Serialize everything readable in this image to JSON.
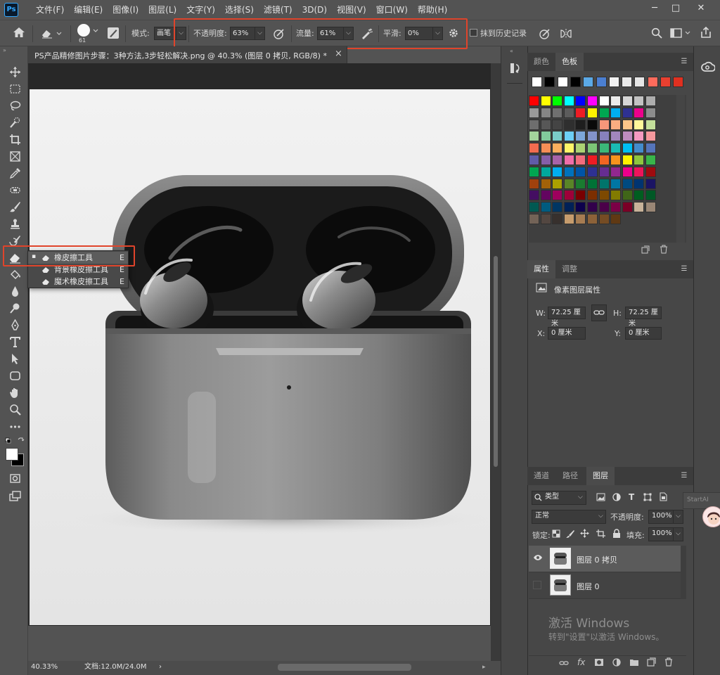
{
  "app": {
    "logo": "Ps"
  },
  "menubar": {
    "items": [
      "文件(F)",
      "编辑(E)",
      "图像(I)",
      "图层(L)",
      "文字(Y)",
      "选择(S)",
      "滤镜(T)",
      "3D(D)",
      "视图(V)",
      "窗口(W)",
      "帮助(H)"
    ]
  },
  "window_controls": {
    "minimize": "─",
    "maximize": "□",
    "close": "✕"
  },
  "options": {
    "brush_size": "61",
    "mode_label": "模式:",
    "mode_value": "画笔",
    "opacity_label": "不透明度:",
    "opacity_value": "63%",
    "flow_label": "流量:",
    "flow_value": "61%",
    "smooth_label": "平滑:",
    "smooth_value": "0%",
    "erase_history_label": "抹到历史记录"
  },
  "document": {
    "tab_title": "PS产品精修图片步骤：3种方法,3步轻松解决.png @ 40.3% (图层 0 拷贝, RGB/8) *",
    "close_glyph": "×",
    "zoom": "40.33%",
    "doc_size": "文档:12.0M/24.0M",
    "arrow": "›"
  },
  "tool_flyout": {
    "items": [
      {
        "label": "橡皮擦工具",
        "shortcut": "E",
        "active": true
      },
      {
        "label": "背景橡皮擦工具",
        "shortcut": "E",
        "active": false
      },
      {
        "label": "魔术橡皮擦工具",
        "shortcut": "E",
        "active": false
      }
    ]
  },
  "swatches_panel": {
    "tabs": [
      "颜色",
      "色板"
    ],
    "active_tab": "色板",
    "recent": [
      "#ffffff",
      "#000000",
      "#ffffff",
      "#000000",
      "#5ba9e6",
      "#4b7fd1",
      "#f2f2f2",
      "#eaeaea",
      "#e6e6e6",
      "#ff6b5c",
      "#e84030",
      "#e03020"
    ],
    "rows": [
      [
        "#ff0000",
        "#ffff00",
        "#00ff00",
        "#00ffff",
        "#0000ff",
        "#ff00ff",
        "#ffffff",
        "#ebebeb",
        "#d6d6d6",
        "#c2c2c2",
        "#adadad"
      ],
      [
        "#999999",
        "#858585",
        "#707070",
        "#5c5c5c",
        "#ee1c24",
        "#fff200",
        "#00a651",
        "#00aeef",
        "#2e3192",
        "#ec008c",
        "#8c8c8c"
      ],
      [
        "#6e6e6e",
        "#575757",
        "#444444",
        "#2f2f2f",
        "#1e1e1e",
        "#0a0a0a",
        "#f7977a",
        "#f9ad81",
        "#fdc68a",
        "#fff79a",
        "#c4df9b"
      ],
      [
        "#a3d39c",
        "#82ca9c",
        "#7accc8",
        "#6dcff6",
        "#7da7d9",
        "#8393ca",
        "#8781bd",
        "#a186be",
        "#bd8cbf",
        "#f49ac1",
        "#f5989d"
      ],
      [
        "#f26c4f",
        "#f68e56",
        "#fbaf5d",
        "#fff568",
        "#acd373",
        "#7cc576",
        "#3bb878",
        "#1abbb4",
        "#00bff3",
        "#448ccb",
        "#5574b9"
      ],
      [
        "#605ca8",
        "#855fa8",
        "#a863a8",
        "#f06eaa",
        "#f26d7d",
        "#ed1c24",
        "#f26522",
        "#f7941d",
        "#fff200",
        "#8dc63f",
        "#39b54a"
      ],
      [
        "#00a651",
        "#00a99d",
        "#00aeef",
        "#0072bc",
        "#0054a6",
        "#2e3192",
        "#662d91",
        "#92278f",
        "#ec008c",
        "#ed145b",
        "#9e0b0f"
      ],
      [
        "#a0410d",
        "#a36209",
        "#aba000",
        "#598527",
        "#1a7b30",
        "#007236",
        "#00746b",
        "#0076a3",
        "#004a80",
        "#003471",
        "#1b1464"
      ],
      [
        "#440e62",
        "#630460",
        "#9e005d",
        "#9e0039",
        "#790000",
        "#7b2e00",
        "#7d4900",
        "#827b00",
        "#406618",
        "#005e20",
        "#005826"
      ],
      [
        "#005952",
        "#005b7f",
        "#003663",
        "#002157",
        "#0d004c",
        "#32004b",
        "#4b0049",
        "#7b0046",
        "#7a0026",
        "#c7b299",
        "#998675"
      ],
      [
        "#736357",
        "#534741",
        "#37302d",
        "#c69c6d",
        "#a67c52",
        "#8c6239",
        "#754c24",
        "#603913"
      ]
    ]
  },
  "properties_panel": {
    "tabs": [
      "属性",
      "调整"
    ],
    "active_tab": "属性",
    "section_title": "像素图层属性",
    "w_label": "W:",
    "w_value": "72.25 厘米",
    "h_label": "H:",
    "h_value": "72.25 厘米",
    "x_label": "X:",
    "x_value": "0 厘米",
    "y_label": "Y:",
    "y_value": "0 厘米"
  },
  "layers_panel": {
    "tabs": [
      "通道",
      "路径",
      "图层"
    ],
    "active_tab": "图层",
    "filter_label": "类型",
    "blend_mode": "正常",
    "opacity_label": "不透明度:",
    "opacity_value": "100%",
    "lock_label": "锁定:",
    "fill_label": "填充:",
    "fill_value": "100%",
    "layers": [
      {
        "name": "图层 0 拷贝",
        "visible": true,
        "selected": true
      },
      {
        "name": "图层 0",
        "visible": false,
        "selected": false
      }
    ]
  },
  "side": {
    "startai_label": "StartAI"
  },
  "watermark": {
    "line1": "激活 Windows",
    "line2": "转到\"设置\"以激活 Windows。"
  }
}
